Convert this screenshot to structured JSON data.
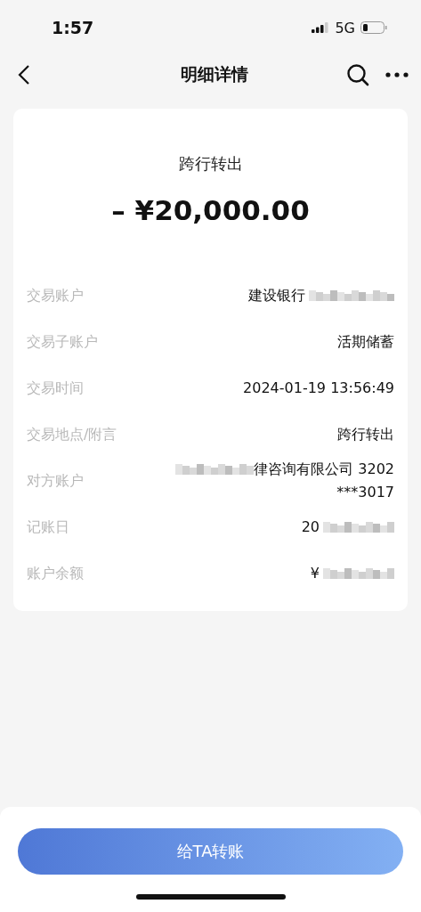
{
  "status_bar": {
    "time": "1:57",
    "network": "5G"
  },
  "nav": {
    "title": "明细详情"
  },
  "summary": {
    "type": "跨行转出",
    "amount": "– ¥20,000.00"
  },
  "details": [
    {
      "label": "交易账户",
      "lines": [
        "建设银行"
      ],
      "blurred_before": false,
      "blurred_after": true
    },
    {
      "label": "交易子账户",
      "lines": [
        "活期储蓄"
      ],
      "blurred_before": false,
      "blurred_after": false
    },
    {
      "label": "交易时间",
      "lines": [
        "2024-01-19 13:56:49"
      ],
      "blurred_before": false,
      "blurred_after": false
    },
    {
      "label": "交易地点/附言",
      "lines": [
        "跨行转出"
      ],
      "blurred_before": false,
      "blurred_after": false
    },
    {
      "label": "对方账户",
      "lines": [
        "律咨询有限公司 3202",
        "***3017"
      ],
      "blurred_before": true,
      "blurred_after": false
    },
    {
      "label": "记账日",
      "lines": [
        "20"
      ],
      "blurred_before": false,
      "blurred_after": true
    },
    {
      "label": "账户余额",
      "lines": [
        "¥"
      ],
      "blurred_before": false,
      "blurred_after": true
    }
  ],
  "action": {
    "label": "给TA转账"
  }
}
